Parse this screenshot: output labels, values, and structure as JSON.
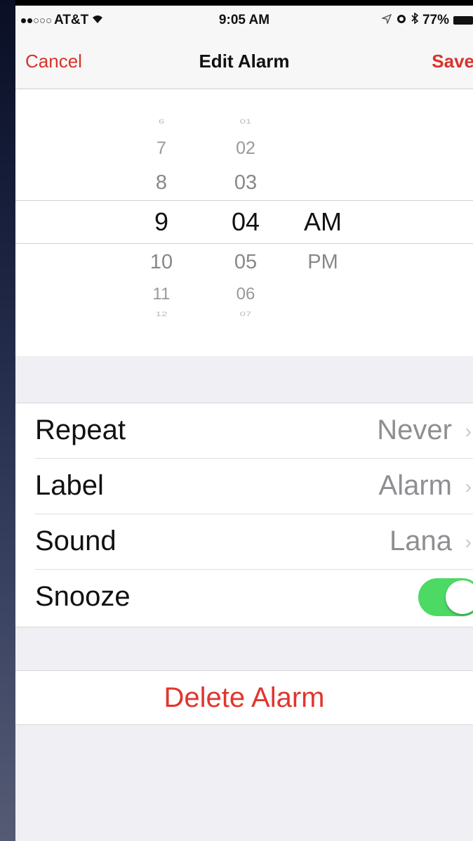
{
  "status_bar": {
    "carrier": "AT&T",
    "time": "9:05 AM",
    "battery_percent": "77%",
    "icons": [
      "signal-dots",
      "wifi-icon",
      "location-icon",
      "alarm-icon",
      "bluetooth-icon",
      "battery-icon"
    ]
  },
  "nav": {
    "cancel": "Cancel",
    "title": "Edit Alarm",
    "save": "Save"
  },
  "picker": {
    "hours": [
      "6",
      "7",
      "8",
      "9",
      "10",
      "11",
      "12"
    ],
    "minutes": [
      "01",
      "02",
      "03",
      "04",
      "05",
      "06",
      "07"
    ],
    "periods": [
      "AM",
      "PM"
    ],
    "selected_hour": "9",
    "selected_minute": "04",
    "selected_period": "AM"
  },
  "settings": {
    "repeat": {
      "label": "Repeat",
      "value": "Never"
    },
    "label": {
      "label": "Label",
      "value": "Alarm"
    },
    "sound": {
      "label": "Sound",
      "value": "Lana"
    },
    "snooze": {
      "label": "Snooze",
      "on": true
    }
  },
  "delete": {
    "label": "Delete Alarm"
  },
  "colors": {
    "accent_red": "#d8332b",
    "toggle_green": "#4cd964",
    "background": "#efeff4"
  }
}
